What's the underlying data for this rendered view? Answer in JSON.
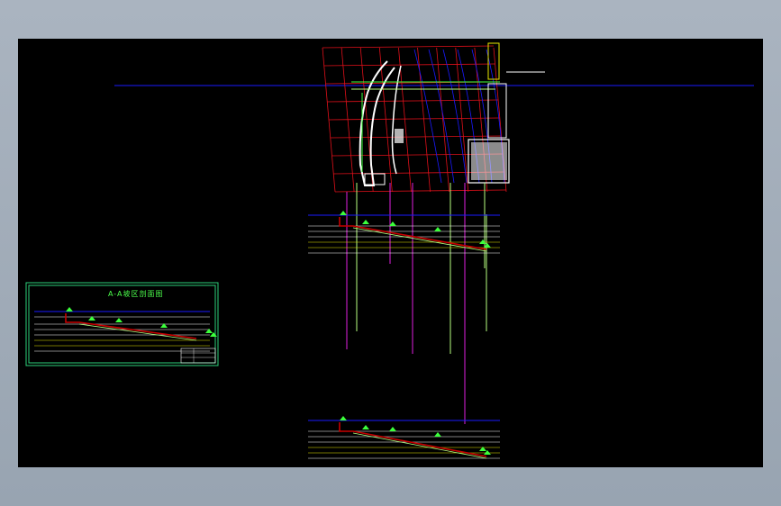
{
  "drawing": {
    "section_title": "A-A坡区剖面图"
  },
  "colors": {
    "background": "#000000",
    "window_frame": "#a5b0bc",
    "grid_red": "#e0101a",
    "blue_line": "#1a1aff",
    "magenta": "#e020e0",
    "green": "#3cff3c",
    "light_green": "#b8ff80",
    "yellow": "#e8e800",
    "white": "#ffffff",
    "dark_red": "#c80000",
    "frame_green": "#2bd07a"
  },
  "icons": {
    "sheet_border": "rectangle",
    "tree_marker": "tree-symbol"
  }
}
